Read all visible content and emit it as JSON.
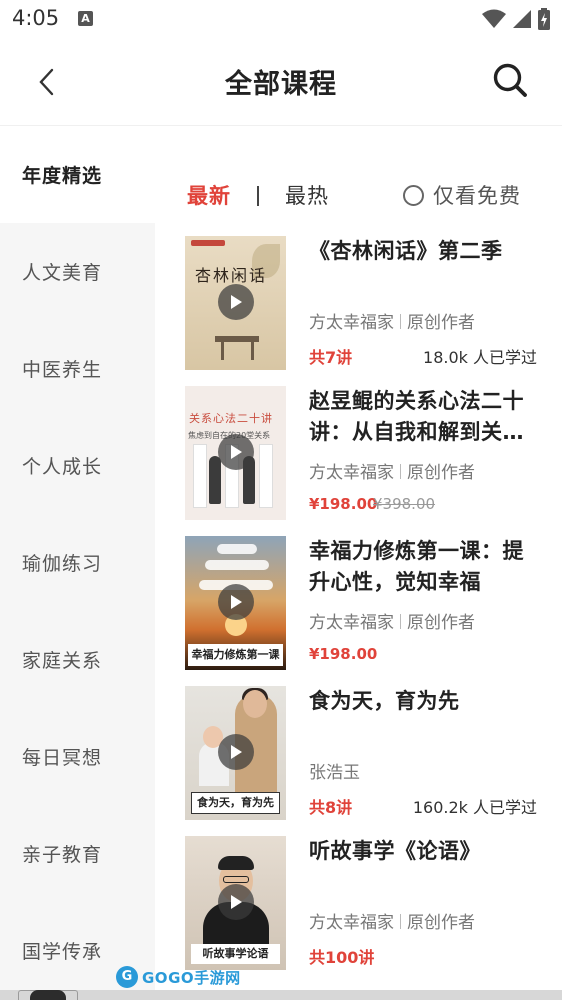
{
  "status_bar": {
    "time": "4:05",
    "notification_badge": "A",
    "icons": [
      "wifi-icon",
      "signal-icon",
      "battery-icon"
    ]
  },
  "header": {
    "title": "全部课程",
    "back_icon": "chevron-left-icon",
    "search_icon": "search-icon"
  },
  "sidebar": {
    "items": [
      {
        "label": "年度精选",
        "active": true
      },
      {
        "label": "人文美育",
        "active": false
      },
      {
        "label": "中医养生",
        "active": false
      },
      {
        "label": "个人成长",
        "active": false
      },
      {
        "label": "瑜伽练习",
        "active": false
      },
      {
        "label": "家庭关系",
        "active": false
      },
      {
        "label": "每日冥想",
        "active": false
      },
      {
        "label": "亲子教育",
        "active": false
      },
      {
        "label": "国学传承",
        "active": false
      }
    ]
  },
  "filters": {
    "latest": "最新",
    "hot": "最热",
    "free_only": "仅看免费",
    "active": "latest",
    "free_checked": false
  },
  "courses": [
    {
      "title": "《杏林闲话》第二季",
      "author": "方太幸福家",
      "role": "原创作者",
      "lesson_count": "共7讲",
      "learners": "18.0k 人已学过",
      "thumb_text": "杏林闲话"
    },
    {
      "title": "赵昱鲲的关系心法二十讲：从自我和解到关…",
      "author": "方太幸福家",
      "role": "原创作者",
      "price": "¥198.00",
      "original_price": "¥398.00",
      "thumb_text": "关系心法二十讲",
      "thumb_sub": "焦虑到自在的20堂关系"
    },
    {
      "title": "幸福力修炼第一课：提升心性，觉知幸福",
      "author": "方太幸福家",
      "role": "原创作者",
      "price": "¥198.00",
      "thumb_text": "幸福力修炼第一课"
    },
    {
      "title": "食为天，育为先",
      "author": "张浩玉",
      "lesson_count": "共8讲",
      "learners": "160.2k 人已学过",
      "thumb_text": "食为天，育为先"
    },
    {
      "title": "听故事学《论语》",
      "author": "方太幸福家",
      "role": "原创作者",
      "lesson_count": "共100讲",
      "thumb_text": "听故事学论语"
    }
  ],
  "watermark": {
    "logo": "G",
    "text": "GOGO手游网"
  },
  "colors": {
    "accent": "#e0433a",
    "sidebar_bg": "#f6f6f6",
    "text_primary": "#222222",
    "text_secondary": "#777777"
  }
}
